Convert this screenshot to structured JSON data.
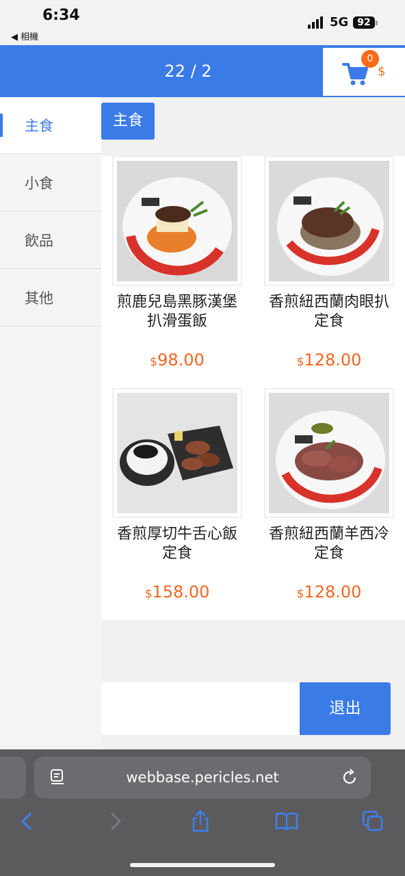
{
  "status_bar": {
    "time": "6:34",
    "back_label": "◀ 相機",
    "network": "5G",
    "battery": "92"
  },
  "header": {
    "page_counter": "22 / 2",
    "cart_count": "0",
    "cart_currency": "$"
  },
  "categories": [
    {
      "label": "主食",
      "active": true
    },
    {
      "label": "小食",
      "active": false
    },
    {
      "label": "飲品",
      "active": false
    },
    {
      "label": "其他",
      "active": false
    }
  ],
  "section_title": "主食",
  "products": [
    {
      "name": "煎鹿兒島黑豚漢堡扒滑蛋飯",
      "currency": "$",
      "price": "98.00"
    },
    {
      "name": "香煎紐西蘭肉眼扒定食",
      "currency": "$",
      "price": "128.00"
    },
    {
      "name": "香煎厚切牛舌心飯定食",
      "currency": "$",
      "price": "158.00"
    },
    {
      "name": "香煎紐西蘭羊西冷定食",
      "currency": "$",
      "price": "128.00"
    }
  ],
  "footer": {
    "logout_label": "退出"
  },
  "browser": {
    "url": "webbase.pericles.net"
  },
  "colors": {
    "accent": "#3b7be8",
    "price": "#f26522",
    "badge": "#ff6a1a"
  }
}
